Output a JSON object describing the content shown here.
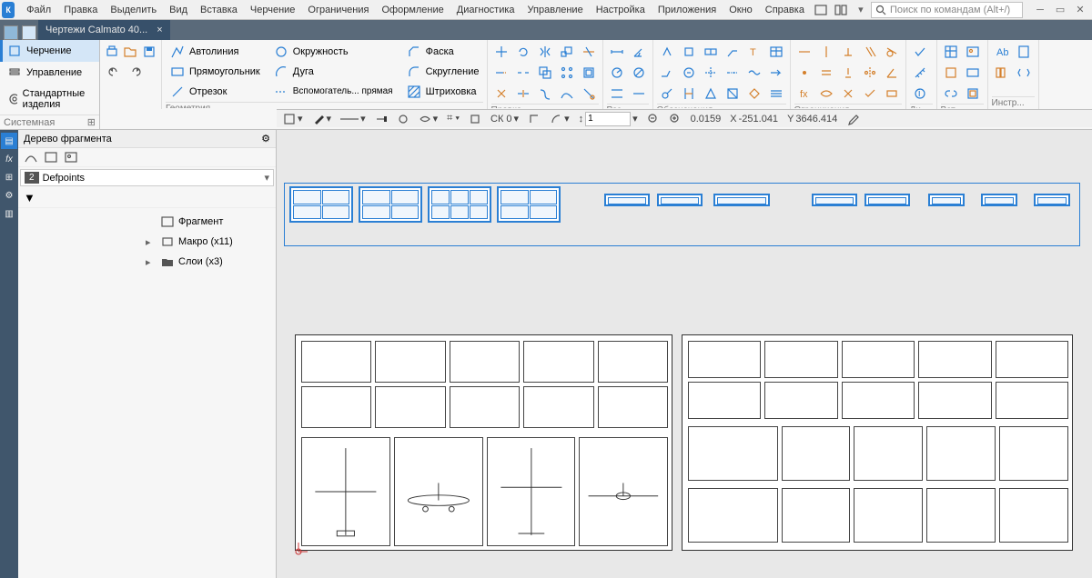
{
  "menu": [
    "Файл",
    "Правка",
    "Выделить",
    "Вид",
    "Вставка",
    "Черчение",
    "Ограничения",
    "Оформление",
    "Диагностика",
    "Управление",
    "Настройка",
    "Приложения",
    "Окно",
    "Справка"
  ],
  "search_placeholder": "Поиск по командам (Alt+/)",
  "doc_tab": "Чертежи Calmato 40...",
  "left_tabs": {
    "drawing": "Черчение",
    "manage": "Управление",
    "std": "Стандартные изделия"
  },
  "group": {
    "system": "Системная",
    "geometry": "Геометрия",
    "edit": "Правка",
    "size": "Раз...",
    "notation": "Обозначения",
    "constraints": "Ограничения",
    "diag": "Ди...",
    "insert": "Вст...",
    "tools": "Инстр..."
  },
  "tools": {
    "autoline": "Автолиния",
    "rect": "Прямоугольник",
    "segment": "Отрезок",
    "circle": "Окружность",
    "arc": "Дуга",
    "helper": "Вспомогатель... прямая",
    "chamfer": "Фаска",
    "fillet": "Скругление",
    "hatch": "Штриховка"
  },
  "panel": {
    "title": "Дерево фрагмента",
    "layer_num": "2",
    "layer_name": "Defpoints"
  },
  "tree": {
    "fragment": "Фрагмент",
    "macro": "Макро (x11)",
    "layers": "Слои (x3)"
  },
  "status": {
    "cs": "СК 0",
    "scale": "1",
    "step": "0.0159",
    "x_label": "X",
    "x": "-251.041",
    "y_label": "Y",
    "y": "3646.414"
  }
}
